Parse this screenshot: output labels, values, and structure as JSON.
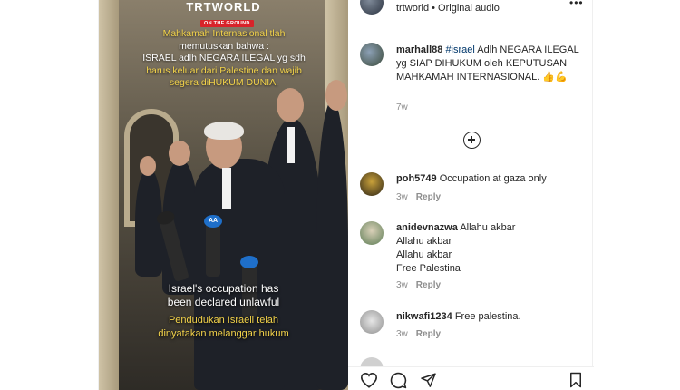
{
  "video": {
    "brand": "TRTWORLD",
    "tag": "ON THE GROUND",
    "headline_lines": [
      "Mahkamah Internasional tlah",
      "memutuskan bahwa :",
      "ISRAEL adlh NEGARA ILEGAL yg sdh",
      "harus keluar dari Palestine dan wajib",
      "segera diHUKUM DUNIA."
    ],
    "caption_en": [
      "Israel's occupation has",
      "been declared unlawful"
    ],
    "caption_id": [
      "Pendudukan Israeli telah",
      "dinyatakan melanggar hukum"
    ],
    "mic_label": "AA"
  },
  "header": {
    "username": "trtworld",
    "separator": "•",
    "audio": "Original audio",
    "more_icon": "more-horizontal-icon"
  },
  "caption": {
    "username": "marhall88",
    "hashtag": "#israel",
    "text": "Adlh NEGARA ILEGAL yg SIAP DIHUKUM oleh KEPUTUSAN MAHKAMAH INTERNASIONAL. 👍💪",
    "time": "7w"
  },
  "comments": [
    {
      "username": "poh5749",
      "lines": [
        "Occupation at gaza only"
      ],
      "time": "3w",
      "reply": "Reply"
    },
    {
      "username": "anidevnazwa",
      "lines": [
        "Allahu akbar",
        "Allahu akbar",
        "Allahu akbar",
        "Free Palestina"
      ],
      "time": "3w",
      "reply": "Reply"
    },
    {
      "username": "nikwafi1234",
      "lines": [
        "Free palestina."
      ],
      "time": "3w",
      "reply": "Reply"
    }
  ],
  "icons": [
    "heart-icon",
    "comment-icon",
    "share-icon",
    "bookmark-icon",
    "plus-circle-icon"
  ]
}
